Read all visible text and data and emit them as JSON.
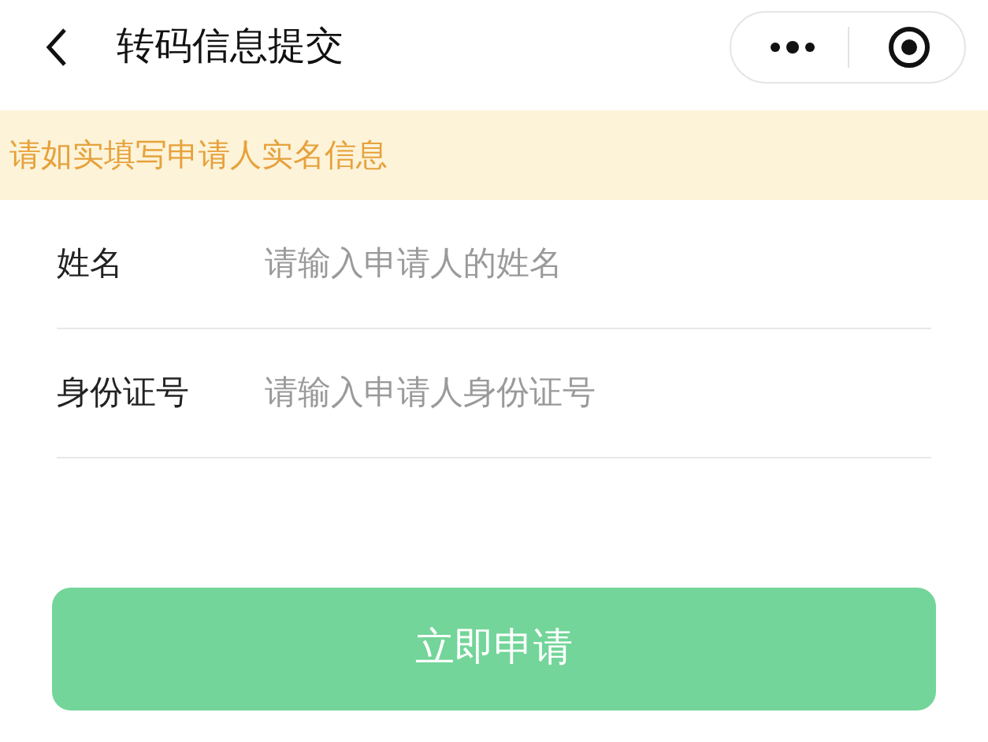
{
  "nav_bar": {
    "title": "转码信息提交"
  },
  "notice": "请如实填写申请人实名信息",
  "fields": [
    {
      "label": "姓名",
      "placeholder": "请输入申请人的姓名"
    },
    {
      "label": "身份证号",
      "placeholder": "请输入申请人身份证号"
    }
  ],
  "submit_button": {
    "label": "立即申请",
    "disabled": true
  }
}
